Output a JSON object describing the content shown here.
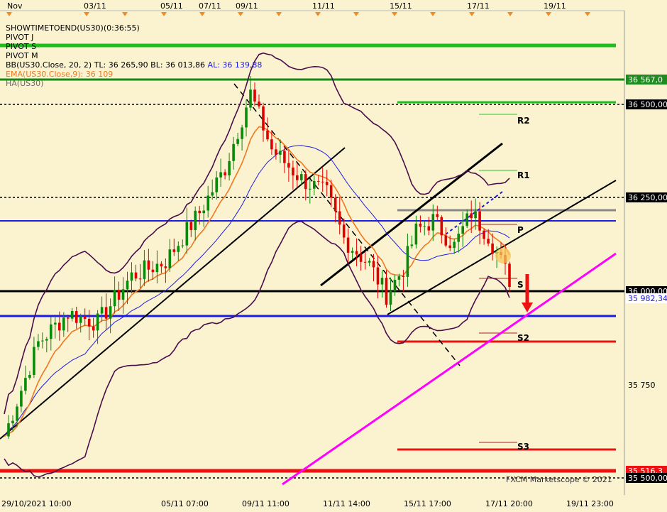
{
  "top_dates": [
    "Nov",
    "03/11",
    "05/11",
    "07/11",
    "09/11",
    "11/11",
    "15/11",
    "17/11",
    "19/11"
  ],
  "bottom_dates": [
    "29/10/2021 10:00",
    "05/11 07:00",
    "09/11 11:00",
    "11/11 14:00",
    "15/11 17:00",
    "17/11 20:00",
    "19/11 23:00"
  ],
  "overlay": {
    "line1": "SHOWTIMETOEND(US30)(0:36:55)",
    "line2": "PIVOT J",
    "line3": "PIVOT S",
    "line4": "PIVOT M",
    "bb_prefix": "BB(US30.Close, 20, 2)  TL: 36 265,90  BL: 36 013,86",
    "bb_al": "AL: 36 139,88",
    "ema": "EMA(US30.Close,9): 36 109",
    "ha": "HA(US30)"
  },
  "watermark": "FXCM Marketscope © 2021",
  "pivot_labels": {
    "r2": "R2",
    "r1": "R1",
    "p": "P",
    "s": "S",
    "s2": "S2",
    "s3": "S3"
  },
  "colors": {
    "background": "#fbf3d0",
    "bull": "#0a8a0a",
    "bear": "#e00000",
    "bollinger": "#4a0d4a",
    "ema": "#f07820",
    "ma": "#1c1ce0",
    "trend": "#000000",
    "support": "#ff00ff",
    "pivot_green": "#1ec01e",
    "pivot_red": "#ee1111"
  },
  "chart_data": {
    "type": "candlestick",
    "symbol": "US30",
    "price_axis_labels": [
      "36 567,0",
      "36 500,00",
      "36 250,00",
      "36 000,00",
      "35 982,34",
      "35 750",
      "35 516,3",
      "35 500,00"
    ],
    "price_tags": [
      {
        "label": "36 567,0",
        "value": 36567,
        "bg": "#1e8c1e",
        "fg": "#ffffff"
      },
      {
        "label": "36 500,00",
        "value": 36500,
        "bg": "#000000",
        "fg": "#ffffff"
      },
      {
        "label": "36 250,00",
        "value": 36250,
        "bg": "#000000",
        "fg": "#ffffff"
      },
      {
        "label": "36 000,00",
        "value": 36000,
        "bg": "#000000",
        "fg": "#ffffff"
      },
      {
        "label": "35 982,34",
        "value": 35982.34,
        "bg": "#ffffff",
        "fg": "#1c1ce0"
      },
      {
        "label": "35 750",
        "value": 35750,
        "bg": null,
        "fg": "#000000"
      },
      {
        "label": "35 516,3",
        "value": 35516.3,
        "bg": "#ee1111",
        "fg": "#ffffff"
      },
      {
        "label": "35 500,00",
        "value": 35500,
        "bg": "#000000",
        "fg": "#ffffff"
      }
    ],
    "candle_count": 120,
    "horizontal_levels": [
      36567,
      36500,
      36250,
      36000,
      35516
    ]
  }
}
